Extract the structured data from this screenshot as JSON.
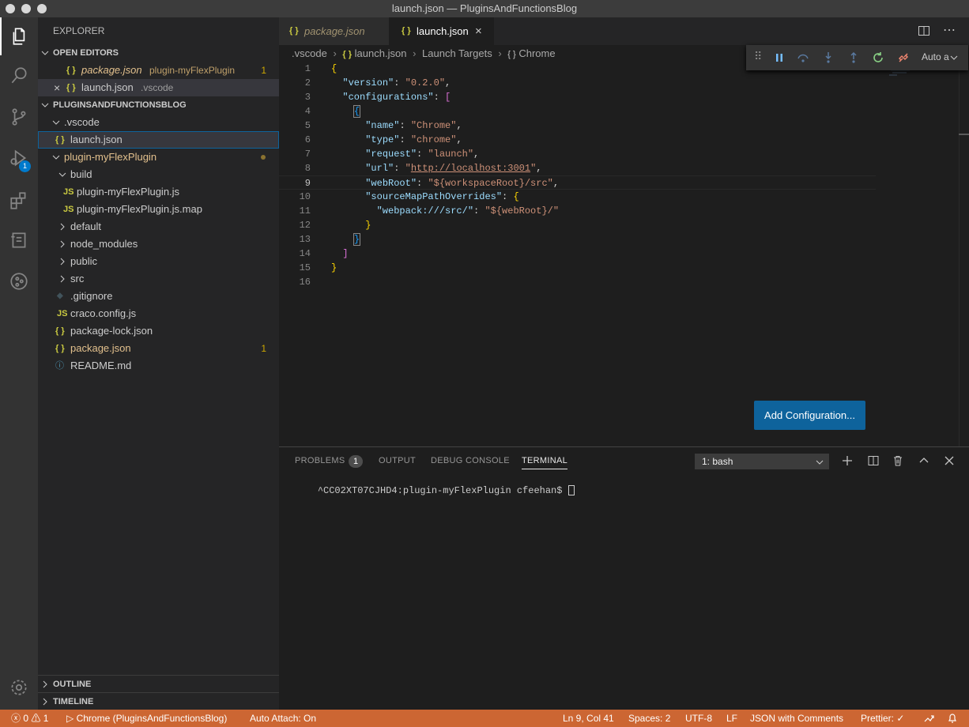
{
  "window": {
    "title": "launch.json — PluginsAndFunctionsBlog"
  },
  "sidebar": {
    "title": "EXPLORER",
    "open_editors_label": "OPEN EDITORS",
    "open_editors": [
      {
        "icon": "{ }",
        "name": "package.json",
        "detail": "plugin-myFlexPlugin",
        "badge": "1"
      },
      {
        "icon": "{ }",
        "name": "launch.json",
        "detail": ".vscode",
        "close": "×"
      }
    ],
    "project_label": "PLUGINSANDFUNCTIONSBLOG",
    "tree": [
      {
        "name": ".vscode"
      },
      {
        "icon": "{ }",
        "name": "launch.json"
      },
      {
        "name": "plugin-myFlexPlugin"
      },
      {
        "name": "build"
      },
      {
        "icon": "JS",
        "name": "plugin-myFlexPlugin.js"
      },
      {
        "icon": "JS",
        "name": "plugin-myFlexPlugin.js.map"
      },
      {
        "name": "default"
      },
      {
        "name": "node_modules"
      },
      {
        "name": "public"
      },
      {
        "name": "src"
      },
      {
        "icon": "◆",
        "name": ".gitignore"
      },
      {
        "icon": "JS",
        "name": "craco.config.js"
      },
      {
        "icon": "{ }",
        "name": "package-lock.json"
      },
      {
        "icon": "{ }",
        "name": "package.json",
        "badge": "1"
      },
      {
        "icon": "ⓘ",
        "name": "README.md"
      }
    ],
    "outline_label": "OUTLINE",
    "timeline_label": "TIMELINE",
    "debug_badge": "1"
  },
  "editor": {
    "tabs": [
      {
        "icon": "{ }",
        "label": "package.json"
      },
      {
        "icon": "{ }",
        "label": "launch.json",
        "close": "×"
      }
    ],
    "breadcrumb": [
      ".vscode",
      "{ }",
      "launch.json",
      "Launch Targets",
      "{ }",
      "Chrome"
    ],
    "lines": [
      "1",
      "2",
      "3",
      "4",
      "5",
      "6",
      "7",
      "8",
      "9",
      "10",
      "11",
      "12",
      "13",
      "14",
      "15",
      "16"
    ],
    "debug_toolbar": {
      "auto_label": "Auto a"
    },
    "add_configuration": "Add Configuration..."
  },
  "panel": {
    "tabs": [
      "PROBLEMS",
      "OUTPUT",
      "DEBUG CONSOLE",
      "TERMINAL"
    ],
    "problems_count": "1",
    "terminal_select": "1: bash",
    "prompt": "^CC02XT07CJHD4:plugin-myFlexPlugin cfeehan$ "
  },
  "statusbar": {
    "errors": "0",
    "warnings": "1",
    "debug_target": "Chrome (PluginsAndFunctionsBlog)",
    "auto_attach": "Auto Attach: On",
    "position": "Ln 9, Col 41",
    "spaces": "Spaces: 2",
    "encoding": "UTF-8",
    "eol": "LF",
    "language": "JSON with Comments",
    "prettier": "Prettier: ✓"
  },
  "colors": {
    "statusbar": "#cc6633",
    "accent": "#0e639c",
    "modified": "#e2c08d"
  }
}
